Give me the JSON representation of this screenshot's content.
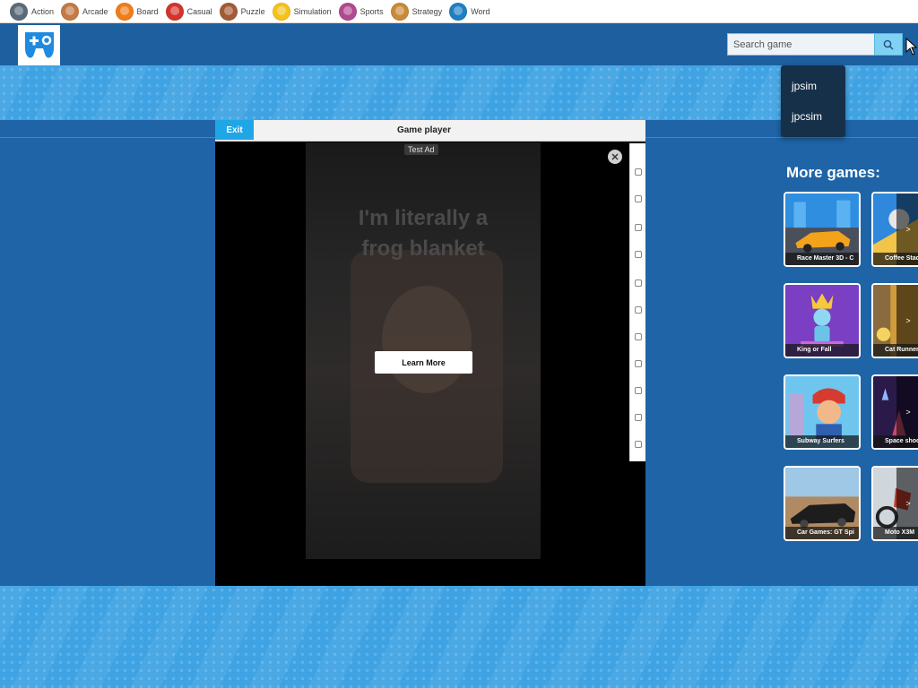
{
  "categories": [
    {
      "label": "Action",
      "icon": "action-icon",
      "color": "#5a6b7a"
    },
    {
      "label": "Arcade",
      "icon": "arcade-icon",
      "color": "#c47a45"
    },
    {
      "label": "Board",
      "icon": "board-icon",
      "color": "#f07d1a"
    },
    {
      "label": "Casual",
      "icon": "casual-icon",
      "color": "#d4342c"
    },
    {
      "label": "Puzzle",
      "icon": "puzzle-icon",
      "color": "#a25b35"
    },
    {
      "label": "Simulation",
      "icon": "simulation-icon",
      "color": "#f5c21b"
    },
    {
      "label": "Sports",
      "icon": "sports-icon",
      "color": "#b04a8f"
    },
    {
      "label": "Strategy",
      "icon": "strategy-icon",
      "color": "#c98a3a"
    },
    {
      "label": "Word",
      "icon": "word-icon",
      "color": "#1e7fc4"
    }
  ],
  "search": {
    "placeholder": "Search game",
    "button_icon": "search-icon",
    "suggestions": [
      "jpsim",
      "jpcsim"
    ]
  },
  "player": {
    "exit_label": "Exit",
    "title": "Game player",
    "ad": {
      "badge": "Test Ad",
      "line1": "I'm literally a",
      "line2": "frog blanket",
      "cta": "Learn More"
    }
  },
  "more_games": {
    "title": "More games:",
    "tiles": [
      {
        "caption": "Race Master 3D - C",
        "art": "race"
      },
      {
        "caption": "King or Fall",
        "art": "king"
      },
      {
        "caption": "Subway Surfers",
        "art": "subway"
      },
      {
        "caption": "Car Games: GT Spi",
        "art": "car"
      }
    ],
    "partial_tiles": [
      {
        "caption": "Coffee Stac",
        "art": "coffee"
      },
      {
        "caption": "Cat Runner",
        "art": "cat"
      },
      {
        "caption": "Space shoo",
        "art": "space"
      },
      {
        "caption": "Moto X3M",
        "art": "moto"
      }
    ]
  },
  "colors": {
    "header": "#1d5f9f",
    "page_bg": "#1e64a6",
    "banner": "#3fa3e3",
    "exit_button": "#1fa6e6",
    "search_button": "#7fd2f4"
  }
}
